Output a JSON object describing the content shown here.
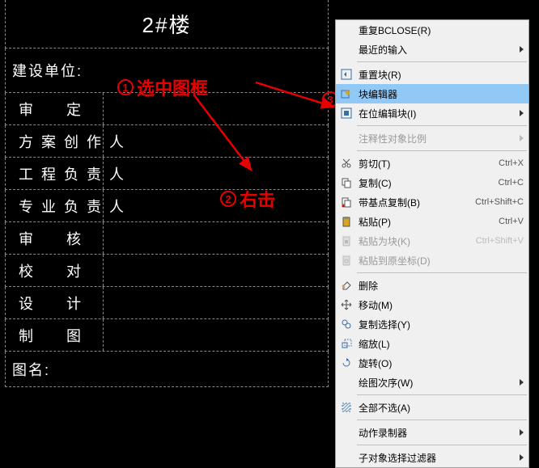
{
  "title_block": {
    "header": "2#楼",
    "unit_label": "建设单位:",
    "rows": [
      "审    定",
      "方案创作人",
      "工程负责人",
      "专业负责人",
      "审    核",
      "校    对",
      "设    计",
      "制    图"
    ],
    "footer_label": "图名:"
  },
  "annotations": {
    "a1_num": "1",
    "a1_text": "选中图框",
    "a2_num": "2",
    "a2_text": "右击",
    "a3_num": "3"
  },
  "menu": {
    "items": [
      {
        "label": "重复BCLOSE(R)"
      },
      {
        "label": "最近的输入",
        "submenu": true
      },
      {
        "sep": true
      },
      {
        "label": "重置块(R)",
        "icon": "reset"
      },
      {
        "label": "块编辑器",
        "icon": "blockedit",
        "highlight": true
      },
      {
        "label": "在位编辑块(I)",
        "icon": "inplace",
        "submenu": true
      },
      {
        "sep": true
      },
      {
        "label": "注释性对象比例",
        "disabled": true,
        "submenu": true
      },
      {
        "sep": true
      },
      {
        "label": "剪切(T)",
        "icon": "cut",
        "shortcut": "Ctrl+X"
      },
      {
        "label": "复制(C)",
        "icon": "copy",
        "shortcut": "Ctrl+C"
      },
      {
        "label": "带基点复制(B)",
        "icon": "copybase",
        "shortcut": "Ctrl+Shift+C"
      },
      {
        "label": "粘贴(P)",
        "icon": "paste",
        "shortcut": "Ctrl+V"
      },
      {
        "label": "粘贴为块(K)",
        "icon": "pasteblock",
        "shortcut": "Ctrl+Shift+V",
        "disabled": true
      },
      {
        "label": "粘贴到原坐标(D)",
        "icon": "pasteorig",
        "disabled": true
      },
      {
        "sep": true
      },
      {
        "label": "删除",
        "icon": "erase"
      },
      {
        "label": "移动(M)",
        "icon": "move"
      },
      {
        "label": "复制选择(Y)",
        "icon": "copysel"
      },
      {
        "label": "缩放(L)",
        "icon": "scale"
      },
      {
        "label": "旋转(O)",
        "icon": "rotate"
      },
      {
        "label": "绘图次序(W)",
        "submenu": true
      },
      {
        "sep": true
      },
      {
        "label": "全部不选(A)",
        "icon": "deselect"
      },
      {
        "sep": true
      },
      {
        "label": "动作录制器",
        "submenu": true
      },
      {
        "sep": true
      },
      {
        "label": "子对象选择过滤器",
        "submenu": true
      }
    ]
  }
}
